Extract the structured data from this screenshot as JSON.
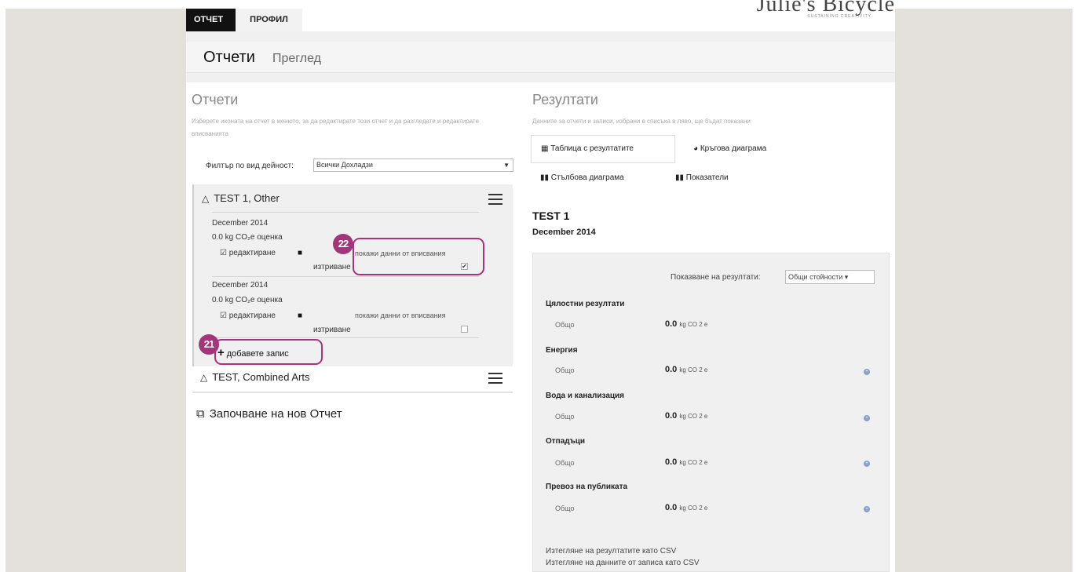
{
  "nav": {
    "tab_report": "ОТЧЕТ",
    "tab_profile": "ПРОФИЛ"
  },
  "brand": {
    "name": "Julie's Bicycle",
    "tagline": "SUSTAINING CREATIVITY"
  },
  "header": {
    "title": "Отчети",
    "subtitle": "Преглед"
  },
  "reports_panel": {
    "title": "Отчети",
    "description": "Изберете иконата на отчет в менюто, за да редактирате този отчет и да разгледате и редактирате вписванията",
    "filter_label": "Филтър по вид дейност:",
    "filter_value": "Всички Дохладзи",
    "reports": [
      {
        "title": "TEST 1, Other",
        "entries": [
          {
            "date": "December 2014",
            "co2": "0.0 kg CO₂e оценка",
            "edit": "редактиране",
            "delete": "изтриване",
            "show": "покажи данни от вписвания",
            "checked": true,
            "check_mark": "✔"
          },
          {
            "date": "December 2014",
            "co2": "0.0 kg CO₂e оценка",
            "edit": "редактиране",
            "delete": "изтриване",
            "show": "покажи данни от вписвания",
            "checked": false,
            "check_mark": ""
          }
        ],
        "add_entry": "добавете запис"
      },
      {
        "title": "TEST, Combined Arts"
      }
    ],
    "new_report": "Започване на нов Отчет"
  },
  "results_panel": {
    "title": "Резултати",
    "description": "Данните за отчети и записи, избрани в списъка в ляво, ще бъдат показани",
    "tabs": [
      "Таблица с резултатите",
      "Кръгова диаграма",
      "Стълбова диаграма",
      "Показатели"
    ],
    "report_title": "TEST 1",
    "report_date": "December 2014",
    "show_results_label": "Показване на резултати:",
    "show_results_value": "Общи стойности",
    "categories": [
      {
        "title": "Цялостни резултати",
        "total_label": "Общо",
        "value": "0.0",
        "unit": "kg CO 2 e"
      },
      {
        "title": "Енергия",
        "total_label": "Общо",
        "value": "0.0",
        "unit": "kg CO 2 e"
      },
      {
        "title": "Вода и канализация",
        "total_label": "Общо",
        "value": "0.0",
        "unit": "kg CO 2 e"
      },
      {
        "title": "Отпадъци",
        "total_label": "Общо",
        "value": "0.0",
        "unit": "kg CO 2 e"
      },
      {
        "title": "Превоз на публиката",
        "total_label": "Общо",
        "value": "0.0",
        "unit": "kg CO 2 e"
      }
    ],
    "export_results": "Изтегляне на резултатите като CSV",
    "export_entries": "Изтегляне на данните от записа като CSV"
  },
  "callouts": [
    {
      "number": "21"
    },
    {
      "number": "22"
    }
  ],
  "colors": {
    "callout": "#a5357a",
    "nav_active": "#111111",
    "background": "#e4e1dd"
  }
}
